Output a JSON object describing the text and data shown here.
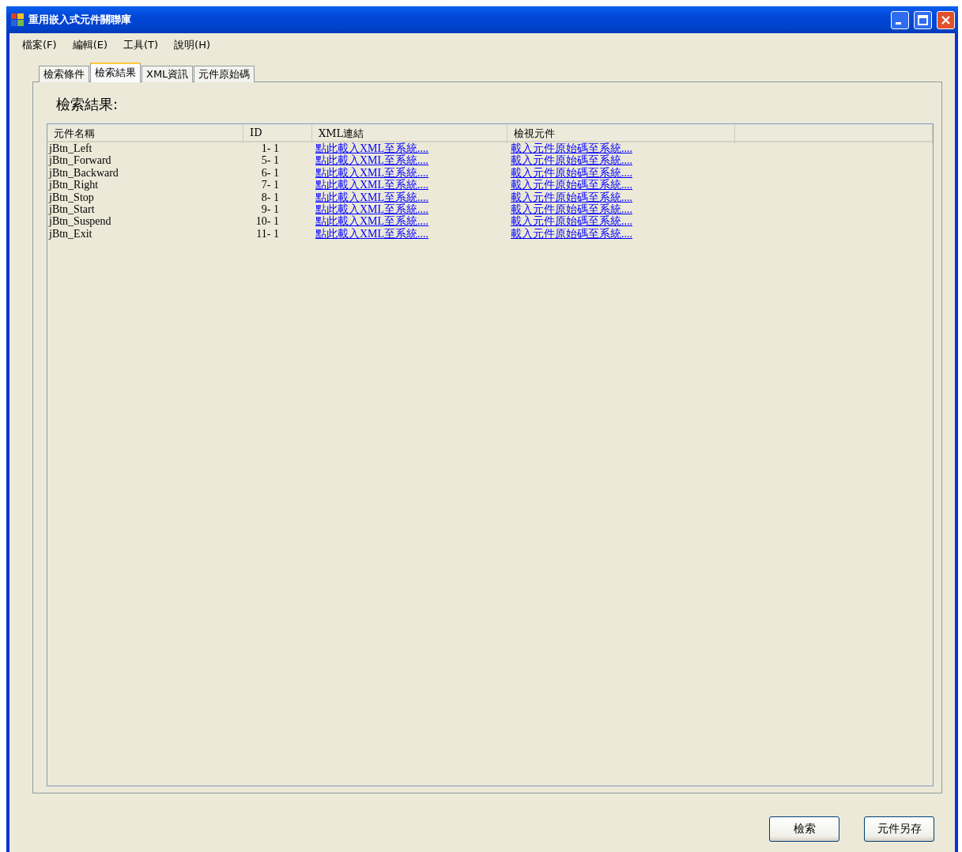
{
  "window": {
    "title": "重用嵌入式元件關聯庫"
  },
  "menu": [
    "檔案(F)",
    "編輯(E)",
    "工具(T)",
    "說明(H)"
  ],
  "tabs": [
    {
      "label": "檢索條件",
      "selected": false
    },
    {
      "label": "檢索結果",
      "selected": true
    },
    {
      "label": "XML資訊",
      "selected": false
    },
    {
      "label": "元件原始碼",
      "selected": false
    }
  ],
  "results_label": "檢索結果:",
  "table": {
    "columns": [
      "元件名稱",
      "ID",
      "XML連結",
      "檢視元件"
    ],
    "rows": [
      {
        "name": "jBtn_Left",
        "id": "1- 1",
        "xml_link": "點此載入XML至系統....",
        "view_link": "載入元件原始碼至系統...."
      },
      {
        "name": "jBtn_Forward",
        "id": "5- 1",
        "xml_link": "點此載入XML至系統....",
        "view_link": "載入元件原始碼至系統...."
      },
      {
        "name": "jBtn_Backward",
        "id": "6- 1",
        "xml_link": "點此載入XML至系統....",
        "view_link": "載入元件原始碼至系統...."
      },
      {
        "name": "jBtn_Right",
        "id": "7- 1",
        "xml_link": "點此載入XML至系統....",
        "view_link": "載入元件原始碼至系統...."
      },
      {
        "name": "jBtn_Stop",
        "id": "8- 1",
        "xml_link": "點此載入XML至系統....",
        "view_link": "載入元件原始碼至系統...."
      },
      {
        "name": "jBtn_Start",
        "id": "9- 1",
        "xml_link": "點此載入XML至系統....",
        "view_link": "載入元件原始碼至系統...."
      },
      {
        "name": "jBtn_Suspend",
        "id": "10- 1",
        "xml_link": "點此載入XML至系統....",
        "view_link": "載入元件原始碼至系統...."
      },
      {
        "name": "jBtn_Exit",
        "id": "11- 1",
        "xml_link": "點此載入XML至系統....",
        "view_link": "載入元件原始碼至系統...."
      }
    ]
  },
  "buttons": [
    "檢索",
    "元件另存"
  ]
}
